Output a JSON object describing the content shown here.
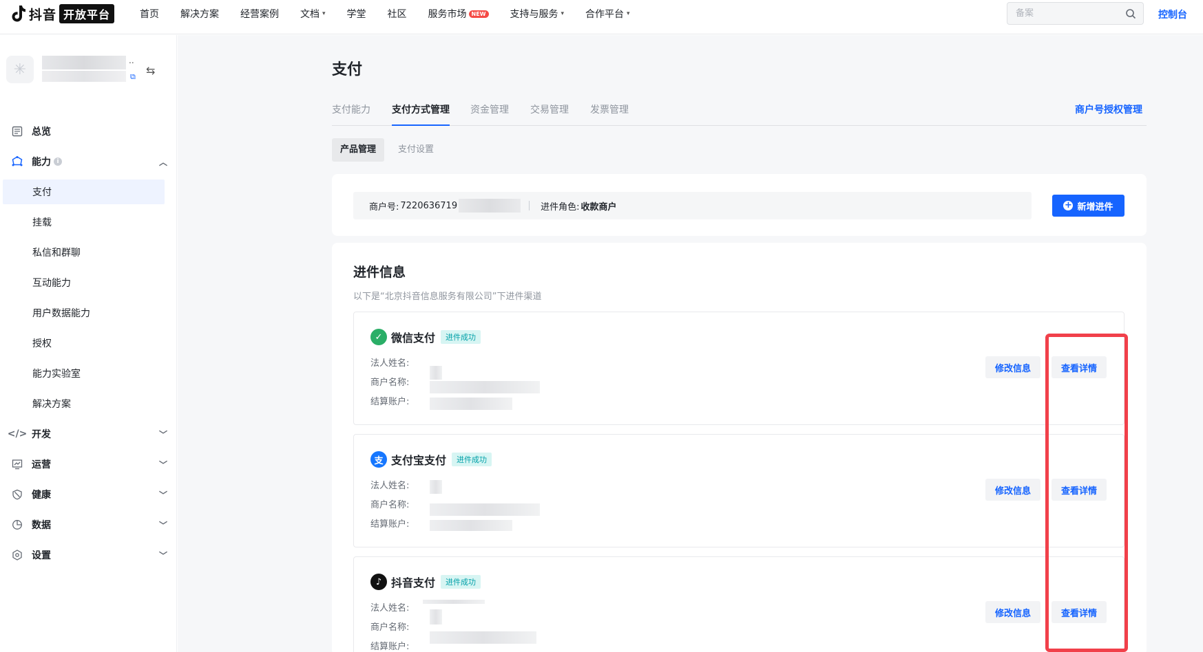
{
  "brand": {
    "name": "抖音",
    "badge": "开放平台"
  },
  "topnav": {
    "items": [
      {
        "label": "首页",
        "dropdown": false
      },
      {
        "label": "解决方案",
        "dropdown": false
      },
      {
        "label": "经营案例",
        "dropdown": false
      },
      {
        "label": "文档",
        "dropdown": true
      },
      {
        "label": "学堂",
        "dropdown": false
      },
      {
        "label": "社区",
        "dropdown": false
      },
      {
        "label": "服务市场",
        "dropdown": false,
        "badge": "NEW"
      },
      {
        "label": "支持与服务",
        "dropdown": true
      },
      {
        "label": "合作平台",
        "dropdown": true
      }
    ],
    "search_placeholder": "备案",
    "console_label": "控制台"
  },
  "sidebar": {
    "menu": [
      {
        "label": "总览",
        "icon": "dashboard-icon",
        "level": "top"
      },
      {
        "label": "能力",
        "icon": "ability-icon",
        "level": "top",
        "expanded": true,
        "info": "i"
      },
      {
        "label": "支付",
        "level": "sub",
        "active": true
      },
      {
        "label": "挂载",
        "level": "sub"
      },
      {
        "label": "私信和群聊",
        "level": "sub"
      },
      {
        "label": "互动能力",
        "level": "sub"
      },
      {
        "label": "用户数据能力",
        "level": "sub"
      },
      {
        "label": "授权",
        "level": "sub"
      },
      {
        "label": "能力实验室",
        "level": "sub"
      },
      {
        "label": "解决方案",
        "level": "sub"
      },
      {
        "label": "开发",
        "icon": "code-icon",
        "level": "top"
      },
      {
        "label": "运营",
        "icon": "operation-icon",
        "level": "top"
      },
      {
        "label": "健康",
        "icon": "health-icon",
        "level": "top"
      },
      {
        "label": "数据",
        "icon": "chart-pie-icon",
        "level": "top"
      },
      {
        "label": "设置",
        "icon": "settings-icon",
        "level": "top"
      }
    ]
  },
  "main": {
    "title": "支付",
    "tabs": [
      "支付能力",
      "支付方式管理",
      "资金管理",
      "交易管理",
      "发票管理"
    ],
    "active_tab": "支付方式管理",
    "auth_link": "商户号授权管理",
    "subtabs": [
      "产品管理",
      "支付设置"
    ],
    "active_subtab": "产品管理",
    "merchant": {
      "id_label": "商户号:",
      "id_value": "7220636719",
      "role_label": "进件角色:",
      "role_value": "收款商户",
      "add_button": "新增进件"
    },
    "section": {
      "title": "进件信息",
      "subtitle": "以下是“北京抖音信息服务有限公司”下进件渠道"
    },
    "field_labels": {
      "legal_name": "法人姓名:",
      "merchant_name": "商户名称:",
      "settlement_account": "结算账户:"
    },
    "payments": [
      {
        "name": "微信支付",
        "status": "进件成功",
        "logo_color": "#2aae67",
        "icon": "wechat-pay-icon"
      },
      {
        "name": "支付宝支付",
        "status": "进件成功",
        "logo_color": "#1677ff",
        "icon": "alipay-icon"
      },
      {
        "name": "抖音支付",
        "status": "进件成功",
        "logo_color": "#111111",
        "icon": "douyin-pay-icon"
      }
    ],
    "edit_label": "修改信息",
    "detail_label": "查看详情"
  },
  "colors": {
    "accent": "#1664ff",
    "highlight": "#f1404a"
  }
}
